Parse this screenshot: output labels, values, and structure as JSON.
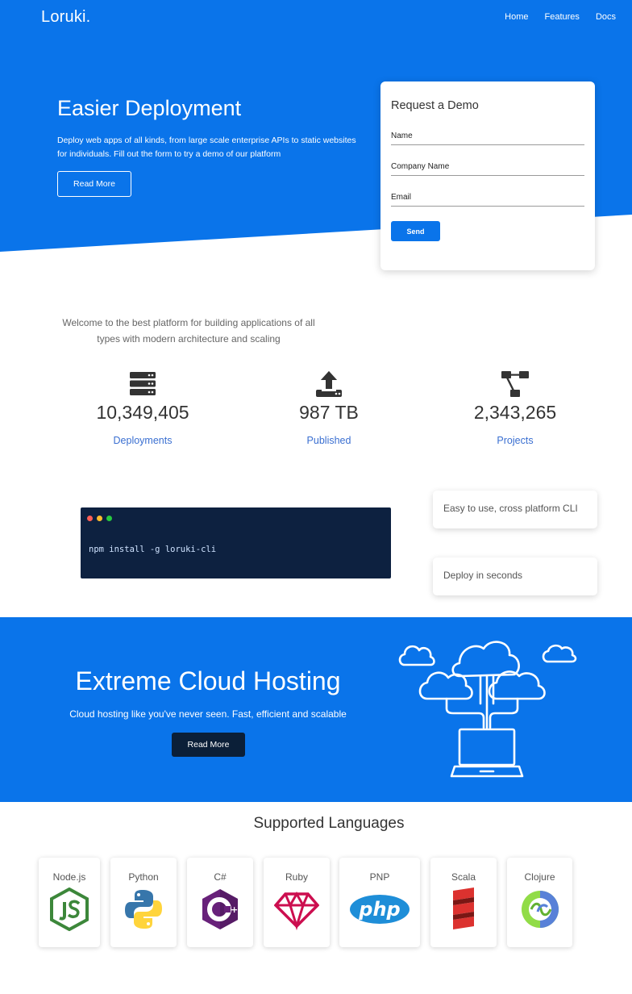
{
  "nav": {
    "brand": "Loruki.",
    "links": [
      "Home",
      "Features",
      "Docs"
    ]
  },
  "hero": {
    "title": "Easier Deployment",
    "description": "Deploy web apps of all kinds, from large scale enterprise APIs to static websites for individuals. Fill out the form to try a demo of our platform",
    "button_label": "Read More"
  },
  "demo_form": {
    "title": "Request a Demo",
    "fields": [
      "Name",
      "Company Name",
      "Email"
    ],
    "send_label": "Send"
  },
  "stats": {
    "welcome": "Welcome to the best platform for building applications of all types with modern architecture and scaling",
    "items": [
      {
        "value": "10,349,405",
        "label": "Deployments",
        "icon": "server-icon"
      },
      {
        "value": "987 TB",
        "label": "Published",
        "icon": "upload-icon"
      },
      {
        "value": "2,343,265",
        "label": "Projects",
        "icon": "project-diagram-icon"
      }
    ]
  },
  "cli": {
    "command": "npm install -g loruki-cli",
    "features": [
      "Easy to use, cross platform CLI",
      "Deploy in seconds"
    ]
  },
  "cloud": {
    "title": "Extreme Cloud Hosting",
    "description": "Cloud hosting like you've never seen. Fast, efficient and scalable",
    "button_label": "Read More"
  },
  "languages": {
    "heading": "Supported Languages",
    "items": [
      "Node.js",
      "Python",
      "C#",
      "Ruby",
      "PNP",
      "Scala",
      "Clojure"
    ]
  },
  "colors": {
    "primary": "#0a74ea",
    "dark": "#0b1f38",
    "terminal_bg": "#0d2140",
    "link_blue": "#3a6fd1"
  }
}
